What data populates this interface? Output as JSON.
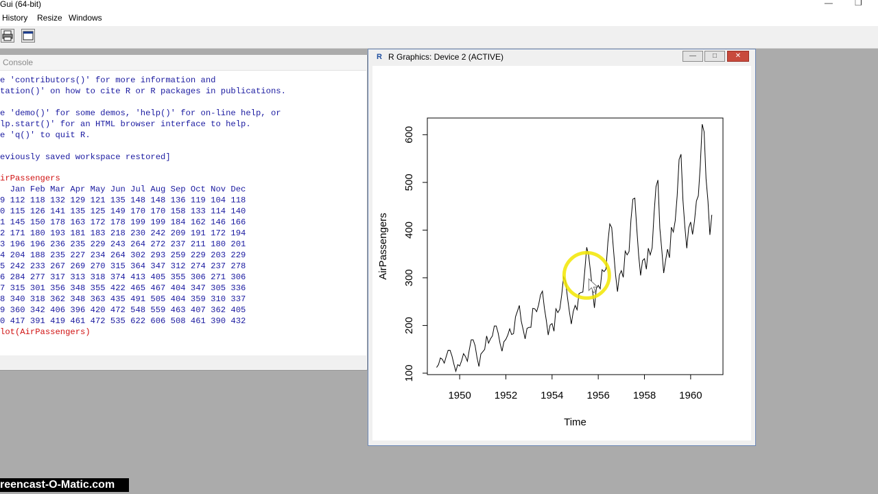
{
  "app": {
    "title": "Gui (64-bit)",
    "minimize_glyph": "—",
    "restore_glyph": "❐"
  },
  "menu": {
    "items": [
      "History",
      "Resize",
      "Windows"
    ]
  },
  "toolbar": {
    "buttons": [
      "print-icon",
      "window-icon"
    ]
  },
  "console": {
    "title": "Console",
    "lines": [
      {
        "text": "e 'contributors()' for more information and",
        "color": "blue"
      },
      {
        "text": "tation()' on how to cite R or R packages in publications.",
        "color": "blue"
      },
      {
        "text": "",
        "color": "blue"
      },
      {
        "text": "e 'demo()' for some demos, 'help()' for on-line help, or",
        "color": "blue"
      },
      {
        "text": "lp.start()' for an HTML browser interface to help.",
        "color": "blue"
      },
      {
        "text": "e 'q()' to quit R.",
        "color": "blue"
      },
      {
        "text": "",
        "color": "blue"
      },
      {
        "text": "eviously saved workspace restored]",
        "color": "blue"
      },
      {
        "text": "",
        "color": "blue"
      },
      {
        "text": "irPassengers",
        "color": "red"
      },
      {
        "text": "  Jan Feb Mar Apr May Jun Jul Aug Sep Oct Nov Dec",
        "color": "blue"
      },
      {
        "text": "9 112 118 132 129 121 135 148 148 136 119 104 118",
        "color": "blue"
      },
      {
        "text": "0 115 126 141 135 125 149 170 170 158 133 114 140",
        "color": "blue"
      },
      {
        "text": "1 145 150 178 163 172 178 199 199 184 162 146 166",
        "color": "blue"
      },
      {
        "text": "2 171 180 193 181 183 218 230 242 209 191 172 194",
        "color": "blue"
      },
      {
        "text": "3 196 196 236 235 229 243 264 272 237 211 180 201",
        "color": "blue"
      },
      {
        "text": "4 204 188 235 227 234 264 302 293 259 229 203 229",
        "color": "blue"
      },
      {
        "text": "5 242 233 267 269 270 315 364 347 312 274 237 278",
        "color": "blue"
      },
      {
        "text": "6 284 277 317 313 318 374 413 405 355 306 271 306",
        "color": "blue"
      },
      {
        "text": "7 315 301 356 348 355 422 465 467 404 347 305 336",
        "color": "blue"
      },
      {
        "text": "8 340 318 362 348 363 435 491 505 404 359 310 337",
        "color": "blue"
      },
      {
        "text": "9 360 342 406 396 420 472 548 559 463 407 362 405",
        "color": "blue"
      },
      {
        "text": "0 417 391 419 461 472 535 622 606 508 461 390 432",
        "color": "blue"
      },
      {
        "text": "lot(AirPassengers)",
        "color": "red"
      }
    ]
  },
  "graphics": {
    "title": "R Graphics: Device 2 (ACTIVE)",
    "icon_letter": "R",
    "buttons": {
      "minimize": "—",
      "maximize": "□",
      "close": "✕"
    }
  },
  "chart_data": {
    "type": "line",
    "xlabel": "Time",
    "ylabel": "AirPassengers",
    "xlim": [
      1948.6,
      1961.4
    ],
    "ylim": [
      97,
      635
    ],
    "x_ticks": [
      1950,
      1952,
      1954,
      1956,
      1958,
      1960
    ],
    "y_ticks": [
      100,
      200,
      300,
      400,
      500,
      600
    ],
    "grid": false,
    "start": 1949,
    "frequency": 12,
    "values": [
      112,
      118,
      132,
      129,
      121,
      135,
      148,
      148,
      136,
      119,
      104,
      118,
      115,
      126,
      141,
      135,
      125,
      149,
      170,
      170,
      158,
      133,
      114,
      140,
      145,
      150,
      178,
      163,
      172,
      178,
      199,
      199,
      184,
      162,
      146,
      166,
      171,
      180,
      193,
      181,
      183,
      218,
      230,
      242,
      209,
      191,
      172,
      194,
      196,
      196,
      236,
      235,
      229,
      243,
      264,
      272,
      237,
      211,
      180,
      201,
      204,
      188,
      235,
      227,
      234,
      264,
      302,
      293,
      259,
      229,
      203,
      229,
      242,
      233,
      267,
      269,
      270,
      315,
      364,
      347,
      312,
      274,
      237,
      278,
      284,
      277,
      317,
      313,
      318,
      374,
      413,
      405,
      355,
      306,
      271,
      306,
      315,
      301,
      356,
      348,
      355,
      422,
      465,
      467,
      404,
      347,
      305,
      336,
      340,
      318,
      362,
      348,
      363,
      435,
      491,
      505,
      404,
      359,
      310,
      337,
      360,
      342,
      406,
      396,
      420,
      472,
      548,
      559,
      463,
      407,
      362,
      405,
      417,
      391,
      419,
      461,
      472,
      535,
      622,
      606,
      508,
      461,
      390,
      432
    ],
    "highlight": {
      "x": 1955.5,
      "y": 305,
      "color": "#f2e600"
    }
  },
  "watermark": {
    "text": "reencast-O-Matic.com"
  }
}
